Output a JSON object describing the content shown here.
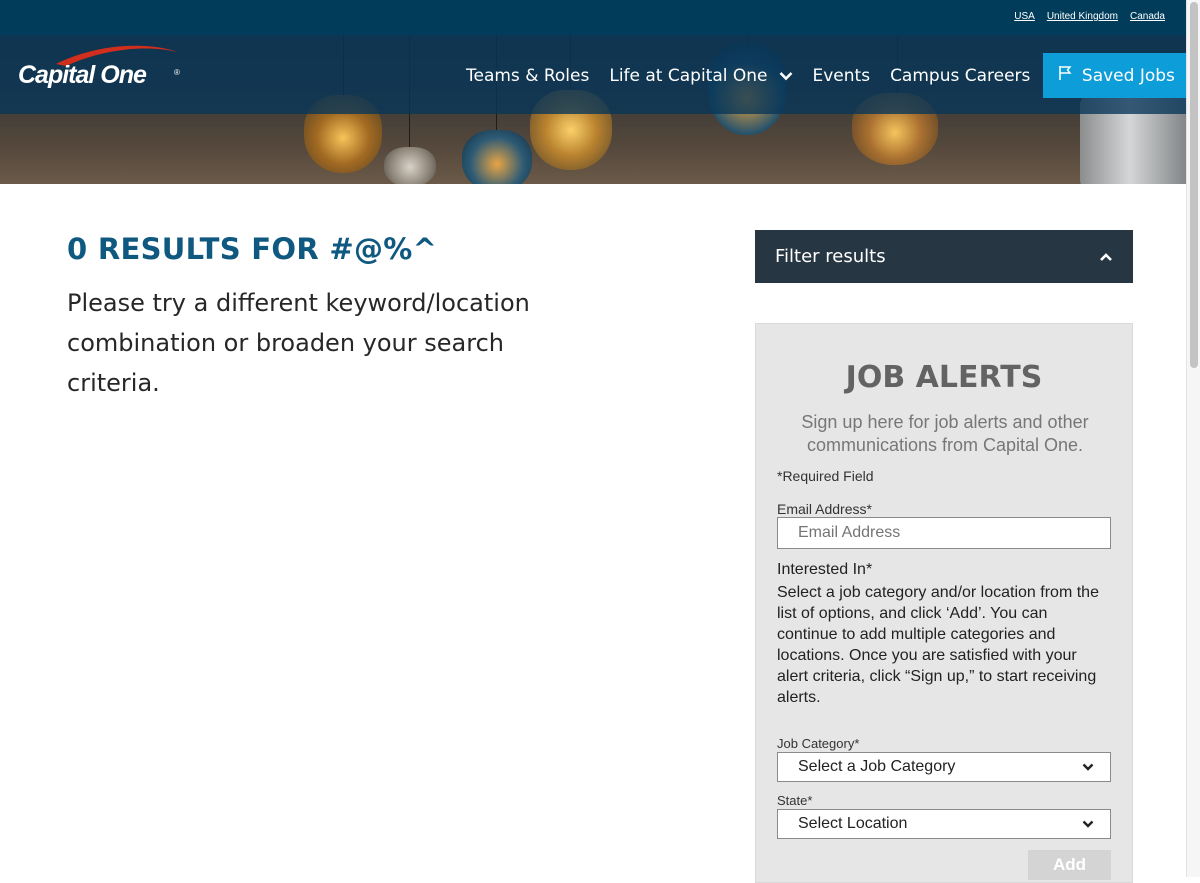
{
  "topbar": {
    "links": [
      "USA",
      "United Kingdom",
      "Canada"
    ]
  },
  "brand": {
    "logo_text": "Capital One",
    "logo_mark": "®",
    "primary_color": "#013d5b",
    "accent_color": "#0d9dd9",
    "swoosh_color": "#d22e1e"
  },
  "nav": {
    "items": [
      "Teams & Roles",
      "Life at Capital One",
      "Events",
      "Campus Careers"
    ],
    "dropdown_icon": "chevron-down-icon",
    "saved_jobs_label": "Saved Jobs",
    "saved_jobs_icon": "flag-icon"
  },
  "results": {
    "title": "0 RESULTS FOR #@%^",
    "message": "Please try a different keyword/location combination or broaden your search criteria."
  },
  "filter": {
    "label": "Filter results",
    "toggle_icon": "chevron-up-icon"
  },
  "alerts": {
    "title": "JOB ALERTS",
    "intro": "Sign up here for job alerts and other communications from Capital One.",
    "required_note": "*Required Field",
    "email_label": "Email Address*",
    "email_placeholder": "Email Address",
    "interest_heading": "Interested In*",
    "interest_text": "Select a job category and/or location from the list of options, and click ‘Add’. You can continue to add multiple categories and locations. Once you are satisfied with your alert criteria, click “Sign up,” to start receiving alerts.",
    "category_label": "Job Category*",
    "category_value": "Select a Job Category",
    "state_label": "State*",
    "state_value": "Select Location",
    "add_label": "Add"
  }
}
